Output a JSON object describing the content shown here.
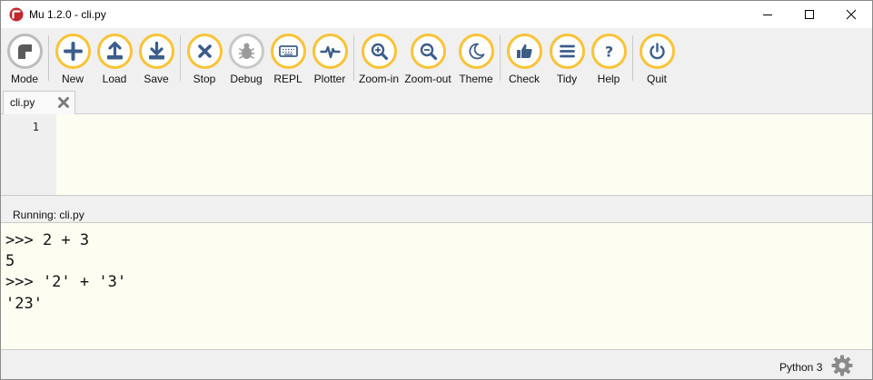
{
  "window": {
    "title": "Mu 1.2.0 - cli.py"
  },
  "colors": {
    "accent_ring": "#f9c335",
    "icon": "#3c5d8a",
    "editor_bg": "#fefdf2",
    "chrome_bg": "#f0f0f0"
  },
  "toolbar": {
    "buttons": [
      {
        "id": "mode",
        "label": "Mode",
        "icon": "mode-icon"
      },
      {
        "id": "new",
        "label": "New",
        "icon": "plus-icon"
      },
      {
        "id": "load",
        "label": "Load",
        "icon": "upload-icon"
      },
      {
        "id": "save",
        "label": "Save",
        "icon": "download-icon"
      },
      {
        "id": "stop",
        "label": "Stop",
        "icon": "close-icon"
      },
      {
        "id": "debug",
        "label": "Debug",
        "icon": "bug-icon"
      },
      {
        "id": "repl",
        "label": "REPL",
        "icon": "keyboard-icon"
      },
      {
        "id": "plotter",
        "label": "Plotter",
        "icon": "pulse-icon"
      },
      {
        "id": "zoom_in",
        "label": "Zoom-in",
        "icon": "zoom-in-icon"
      },
      {
        "id": "zoom_out",
        "label": "Zoom-out",
        "icon": "zoom-out-icon"
      },
      {
        "id": "theme",
        "label": "Theme",
        "icon": "moon-icon"
      },
      {
        "id": "check",
        "label": "Check",
        "icon": "thumbs-up-icon"
      },
      {
        "id": "tidy",
        "label": "Tidy",
        "icon": "lines-icon"
      },
      {
        "id": "help",
        "label": "Help",
        "icon": "question-icon"
      },
      {
        "id": "quit",
        "label": "Quit",
        "icon": "power-icon"
      }
    ]
  },
  "tabs": [
    {
      "label": "cli.py",
      "close_icon": "close-icon"
    }
  ],
  "editor": {
    "line_numbers": [
      "1"
    ]
  },
  "repl": {
    "header": "Running: cli.py",
    "lines": [
      ">>> 2 + 3",
      "5",
      ">>> '2' + '3'",
      "'23'"
    ]
  },
  "status": {
    "mode": "Python 3",
    "settings_icon": "gear-icon"
  }
}
